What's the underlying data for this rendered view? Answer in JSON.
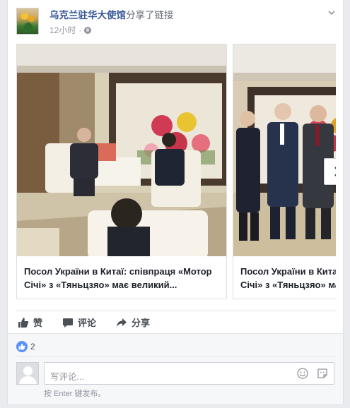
{
  "post": {
    "page_name": "乌克兰驻华大使馆",
    "action": "分享了链接",
    "time": "12小时",
    "separator": "·"
  },
  "carousel": {
    "slides": [
      {
        "caption": "Посол України в Китаї: співпраця «Мотор\nСічі» з «Тяньцзяо» має великий..."
      },
      {
        "caption": "Посол України в Китаї:\nСічі» з «Тяньцзяо» має"
      }
    ]
  },
  "actions": {
    "like": "赞",
    "comment": "评论",
    "share": "分享"
  },
  "reactions": {
    "count": "2"
  },
  "comment_box": {
    "placeholder": "写评论...",
    "hint": "按 Enter 键发布。"
  },
  "colors": {
    "link_blue": "#365899",
    "like_blue": "#5890ff"
  },
  "icons": [
    "globe-icon",
    "chevron-down-icon",
    "next-arrow-icon",
    "thumbs-up-icon",
    "comment-icon",
    "share-icon",
    "emoji-icon",
    "sticker-icon"
  ]
}
